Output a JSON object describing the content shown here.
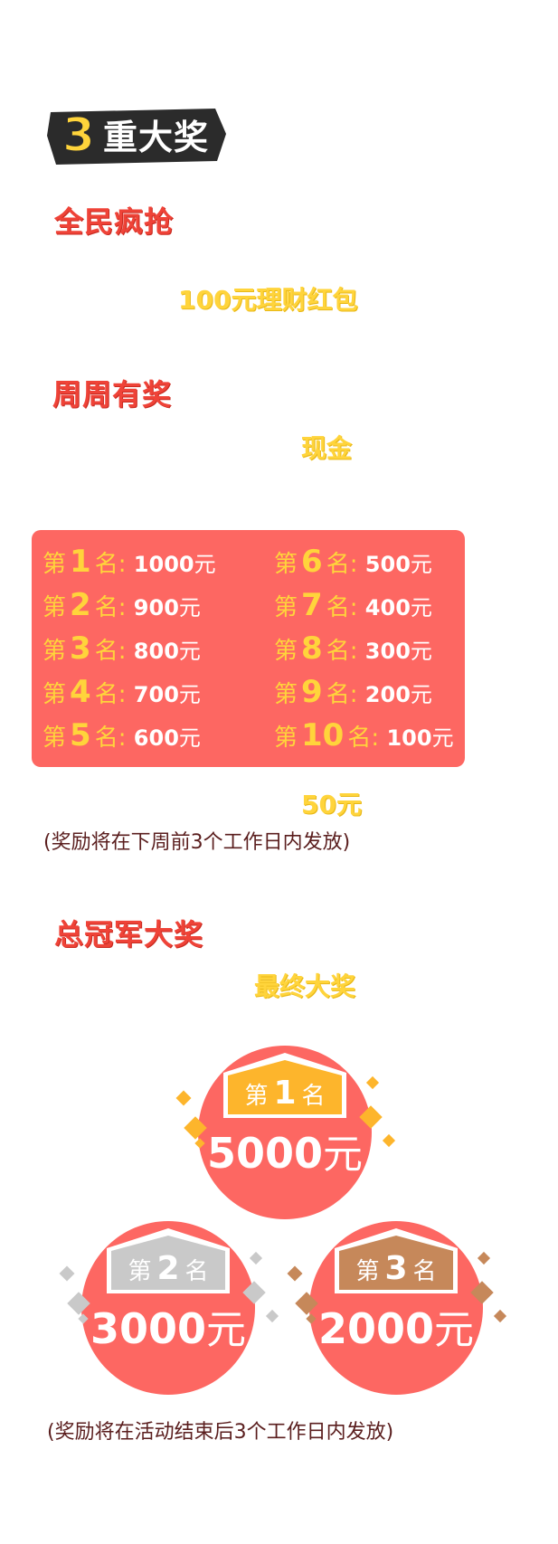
{
  "header": {
    "number": "3",
    "title": "重大奖"
  },
  "section1": {
    "title": "全民疯抢",
    "reward": "100元理财红包"
  },
  "section2": {
    "title": "周周有奖",
    "reward": "现金",
    "prefix": "第",
    "suffix": "名:",
    "unit": "元",
    "ranks": [
      {
        "num": "1",
        "amount": "1000"
      },
      {
        "num": "2",
        "amount": "900"
      },
      {
        "num": "3",
        "amount": "800"
      },
      {
        "num": "4",
        "amount": "700"
      },
      {
        "num": "5",
        "amount": "600"
      },
      {
        "num": "6",
        "amount": "500"
      },
      {
        "num": "7",
        "amount": "400"
      },
      {
        "num": "8",
        "amount": "300"
      },
      {
        "num": "9",
        "amount": "200"
      },
      {
        "num": "10",
        "amount": "100"
      }
    ],
    "extra_reward": "50元",
    "note": "(奖励将在下周前3个工作日内发放)"
  },
  "section3": {
    "title": "总冠军大奖",
    "reward": "最终大奖",
    "prefix": "第",
    "suffix": "名",
    "unit": "元",
    "prizes": [
      {
        "num": "1",
        "amount": "5000",
        "color": "#fdb52c"
      },
      {
        "num": "2",
        "amount": "3000",
        "color": "#c9c9c9"
      },
      {
        "num": "3",
        "amount": "2000",
        "color": "#c6885a"
      }
    ],
    "note": "(奖励将在活动结束后3个工作日内发放)"
  },
  "colors": {
    "red": "#fd6762",
    "title_red": "#ef4338",
    "yellow": "#ffd43b"
  }
}
